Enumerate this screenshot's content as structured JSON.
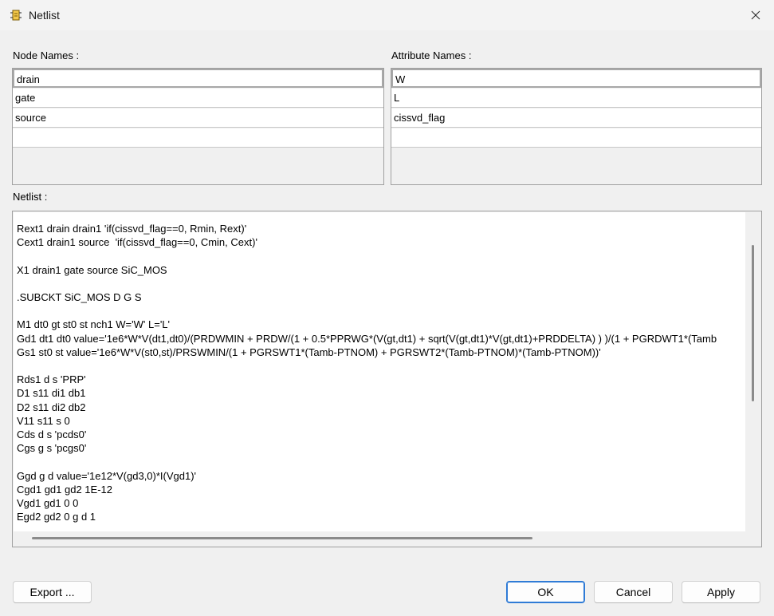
{
  "window": {
    "title": "Netlist",
    "icon": "schematic-component-icon",
    "close_icon": "close-icon"
  },
  "node_names": {
    "label": "Node Names :",
    "rows": [
      "drain",
      "gate",
      "source",
      ""
    ]
  },
  "attribute_names": {
    "label": "Attribute Names :",
    "rows": [
      "W",
      "L",
      "cissvd_flag",
      ""
    ]
  },
  "netlist": {
    "label": "Netlist :",
    "text": "Rext1 drain drain1 'if(cissvd_flag==0, Rmin, Rext)'\nCext1 drain1 source  'if(cissvd_flag==0, Cmin, Cext)'\n\nX1 drain1 gate source SiC_MOS\n\n.SUBCKT SiC_MOS D G S\n\nM1 dt0 gt st0 st nch1 W='W' L='L'\nGd1 dt1 dt0 value='1e6*W*V(dt1,dt0)/(PRDWMIN + PRDW/(1 + 0.5*PPRWG*(V(gt,dt1) + sqrt(V(gt,dt1)*V(gt,dt1)+PRDDELTA) ) )/(1 + PGRDWT1*(Tamb\nGs1 st0 st value='1e6*W*V(st0,st)/PRSWMIN/(1 + PGRSWT1*(Tamb-PTNOM) + PGRSWT2*(Tamb-PTNOM)*(Tamb-PTNOM))'\n\nRds1 d s 'PRP'\nD1 s11 di1 db1\nD2 s11 di2 db2\nV11 s11 s 0\nCds d s 'pcds0'\nCgs g s 'pcgs0'\n\nGgd g d value='1e12*V(gd3,0)*I(Vgd1)'\nCgd1 gd1 gd2 1E-12\nVgd1 gd1 0 0\nEgd2 gd2 0 g d 1"
  },
  "buttons": {
    "export": "Export ...",
    "ok": "OK",
    "cancel": "Cancel",
    "apply": "Apply"
  },
  "colors": {
    "accent": "#2f7bd6",
    "background": "#f0f0f0"
  }
}
